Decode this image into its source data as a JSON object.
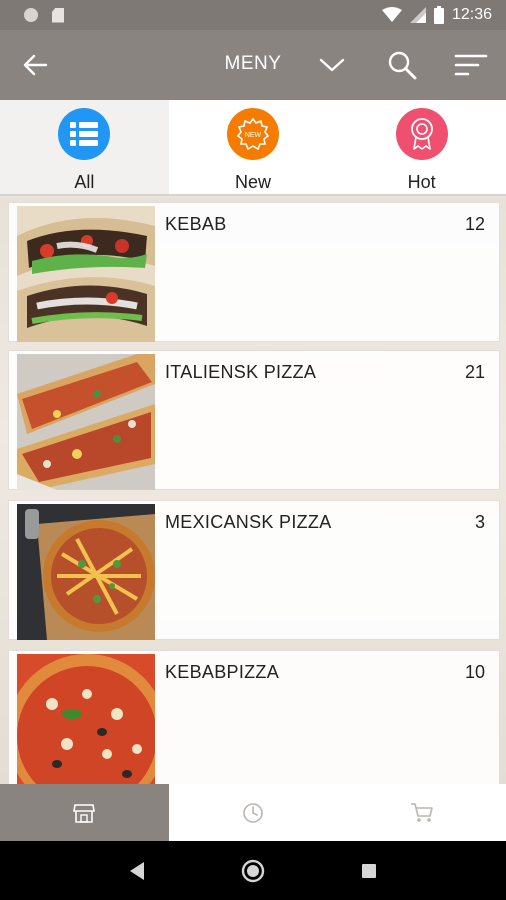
{
  "status_bar": {
    "time": "12:36"
  },
  "header": {
    "title": "MENY"
  },
  "tabs": [
    {
      "label": "All",
      "color": "#2196f3",
      "icon": "list-icon"
    },
    {
      "label": "New",
      "color": "#f57c00",
      "icon": "new-badge-icon",
      "badge_text": "NEW"
    },
    {
      "label": "Hot",
      "color": "#ef5070",
      "icon": "award-icon"
    }
  ],
  "categories": [
    {
      "name": "KEBAB",
      "count": "12"
    },
    {
      "name": "ITALIENSK PIZZA",
      "count": "21"
    },
    {
      "name": "MEXICANSK PIZZA",
      "count": "3"
    },
    {
      "name": "KEBABPIZZA",
      "count": "10"
    }
  ],
  "bottom_nav": [
    {
      "icon": "store-icon",
      "active": true
    },
    {
      "icon": "clock-icon",
      "active": false
    },
    {
      "icon": "cart-icon",
      "active": false
    }
  ],
  "colors": {
    "app_bar": "#8a8480",
    "status_bar": "#7f7975"
  }
}
